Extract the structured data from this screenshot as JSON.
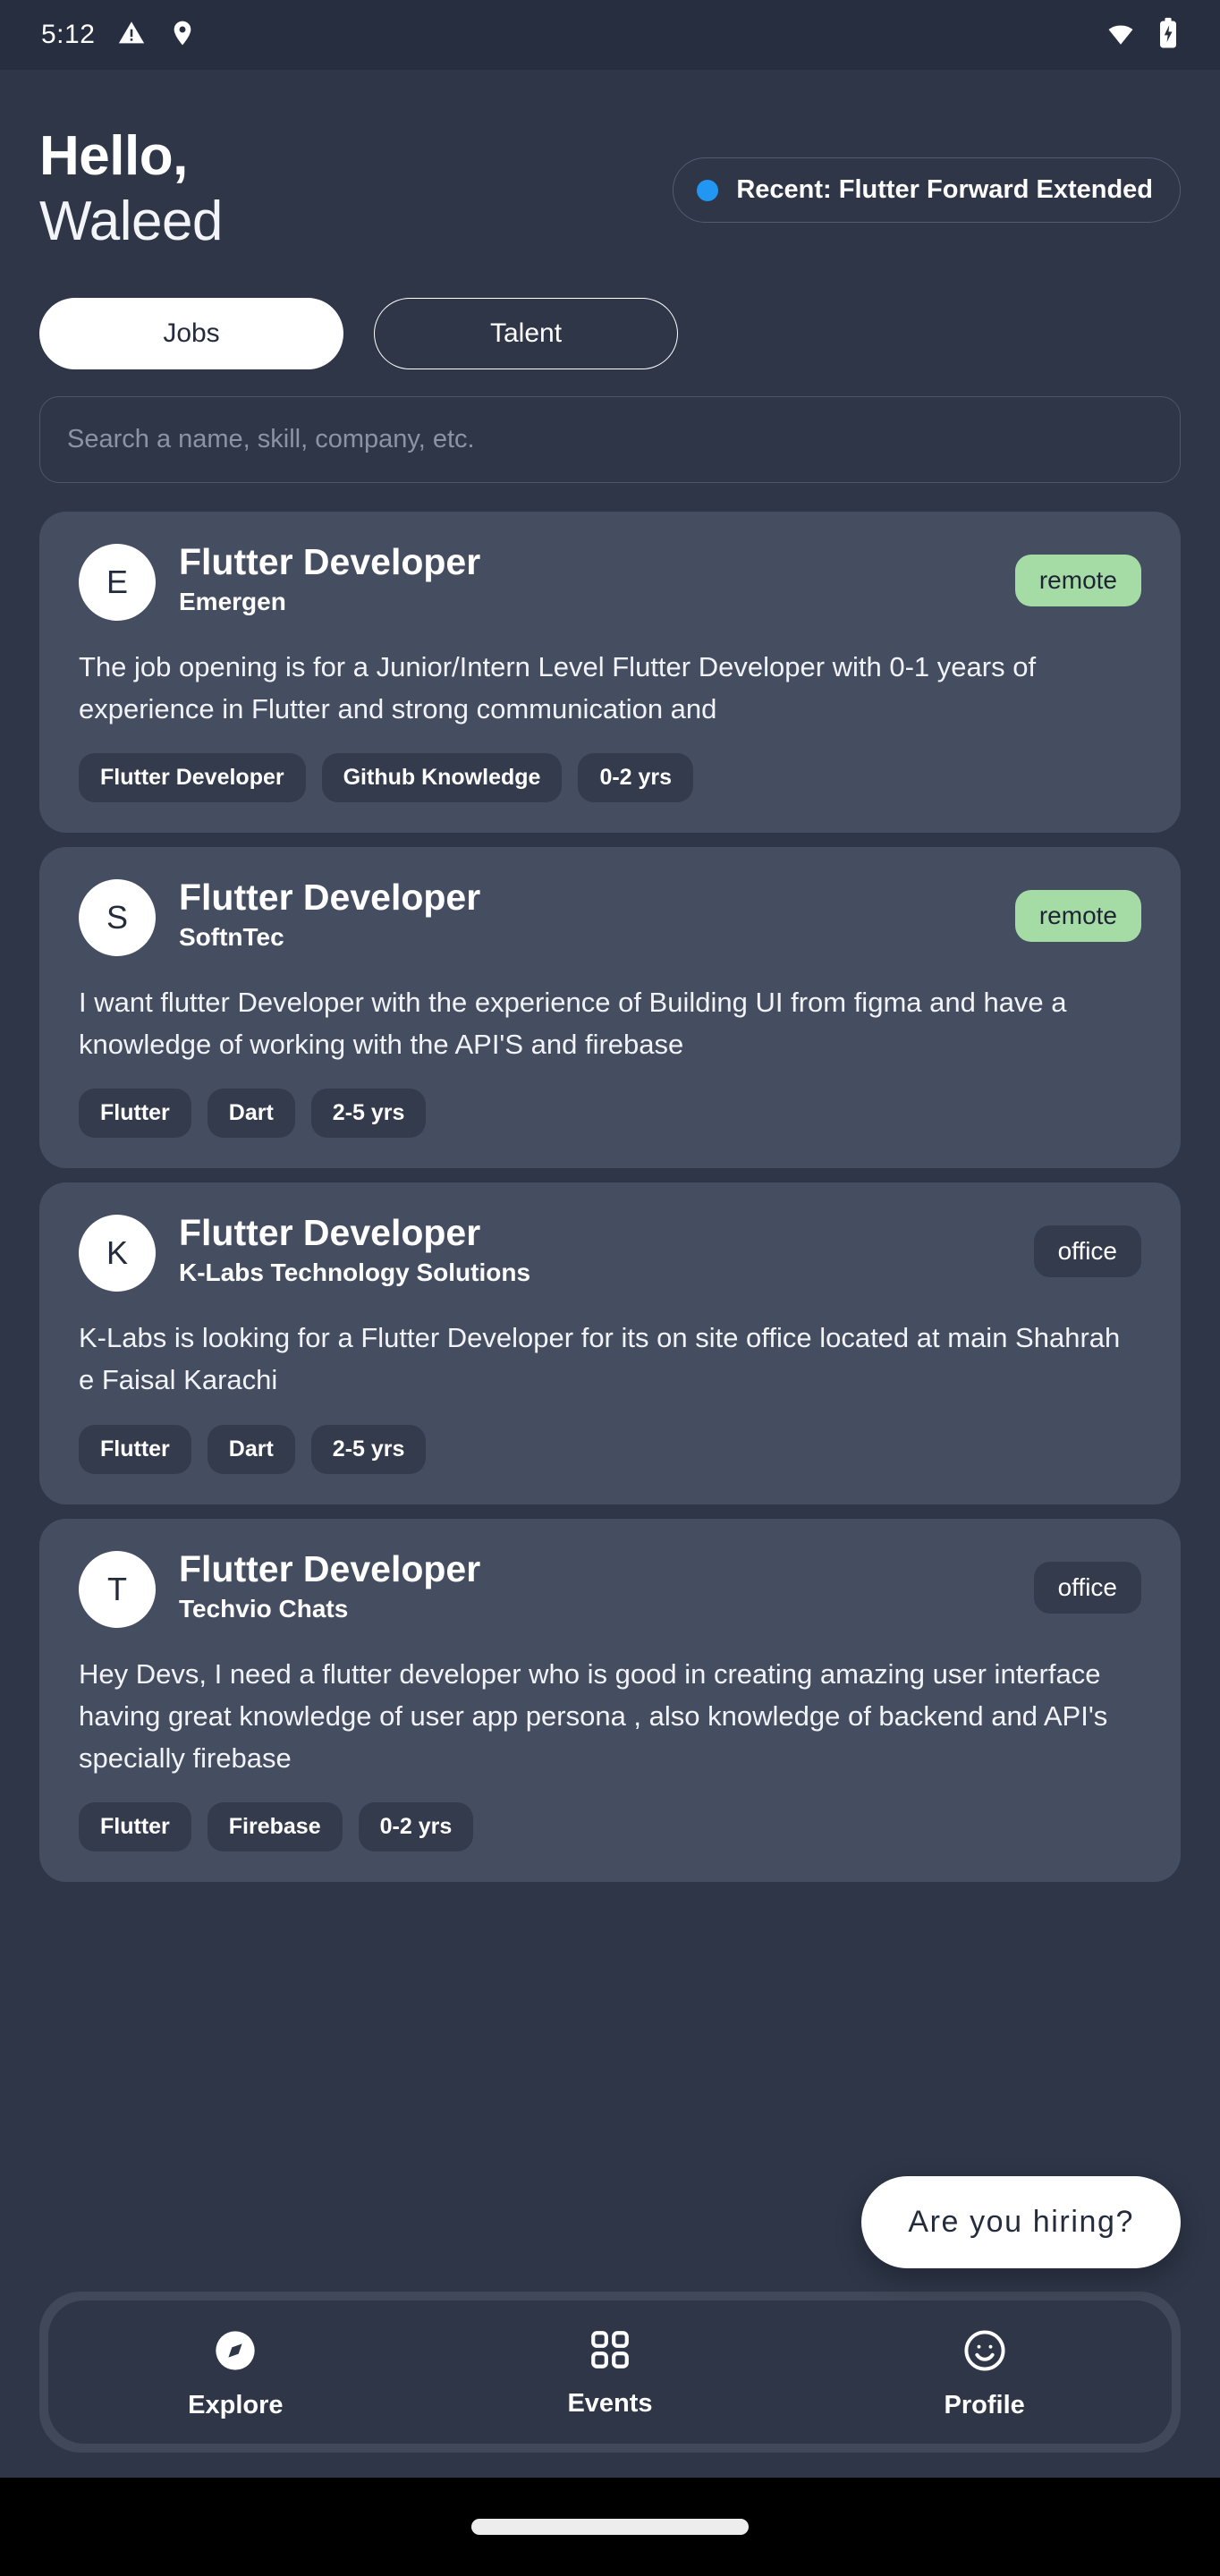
{
  "status_bar": {
    "time": "5:12",
    "left_icons": [
      "warning-triangle-icon",
      "location-pin-icon"
    ],
    "right_icons": [
      "wifi-icon",
      "battery-charging-icon"
    ]
  },
  "header": {
    "greeting": "Hello,",
    "user_name": "Waleed",
    "recent_chip": {
      "dot_color": "#2196f3",
      "text": "Recent: Flutter Forward Extended"
    }
  },
  "tabs": [
    {
      "label": "Jobs",
      "active": true
    },
    {
      "label": "Talent",
      "active": false
    }
  ],
  "search": {
    "value": "",
    "placeholder": "Search a name, skill, company, etc."
  },
  "colors": {
    "page_background": "#2e3648",
    "card_background": "#454d60",
    "remote_badge": "#a5dba5",
    "office_badge": "#343b4d",
    "accent_blue": "#2196f3"
  },
  "jobs": [
    {
      "avatar_letter": "E",
      "title": "Flutter Developer",
      "company": "Emergen",
      "badge": "remote",
      "badge_type": "remote",
      "description": "The job opening is for a Junior/Intern Level Flutter Developer with 0-1 years of experience in Flutter and strong communication and",
      "tags": [
        "Flutter Developer",
        "Github Knowledge",
        "0-2 yrs"
      ]
    },
    {
      "avatar_letter": "S",
      "title": "Flutter Developer",
      "company": "SoftnTec",
      "badge": "remote",
      "badge_type": "remote",
      "description": "I want flutter Developer with the experience of Building UI from figma and have a knowledge of working with the API'S and firebase",
      "tags": [
        "Flutter",
        "Dart",
        "2-5 yrs"
      ]
    },
    {
      "avatar_letter": "K",
      "title": "Flutter Developer",
      "company": "K-Labs Technology Solutions",
      "badge": "office",
      "badge_type": "office",
      "description": "K-Labs is looking for a Flutter Developer for its on site office located at main Shahrah e Faisal Karachi",
      "tags": [
        "Flutter",
        "Dart",
        "2-5 yrs"
      ]
    },
    {
      "avatar_letter": "T",
      "title": "Flutter Developer",
      "company": "Techvio Chats",
      "badge": "office",
      "badge_type": "office",
      "description": "Hey Devs, I need a flutter developer who is good in creating amazing user interface having great knowledge of user app persona , also knowledge of backend and API's specially firebase",
      "tags": [
        "Flutter",
        "Firebase",
        "0-2 yrs"
      ]
    }
  ],
  "fab": {
    "label": "Are you hiring?"
  },
  "bottom_nav": [
    {
      "label": "Explore",
      "icon": "explore-compass-icon",
      "active": true
    },
    {
      "label": "Events",
      "icon": "grid-apps-icon",
      "active": false
    },
    {
      "label": "Profile",
      "icon": "smiley-face-icon",
      "active": false
    }
  ]
}
